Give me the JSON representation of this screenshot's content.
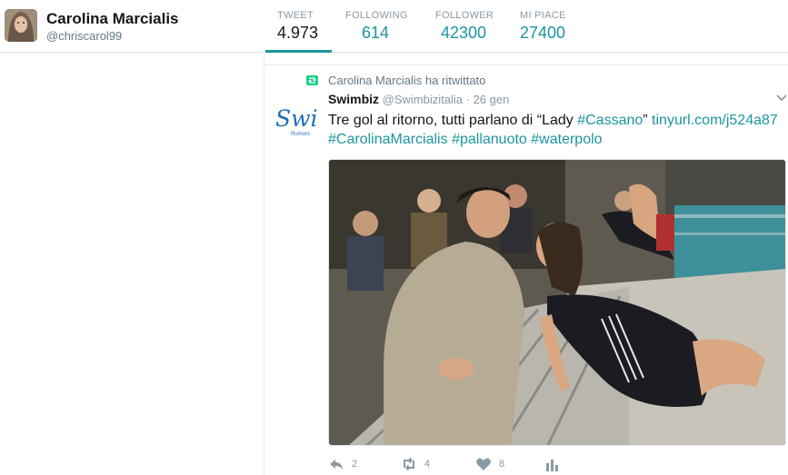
{
  "profile": {
    "name": "Carolina Marcialis",
    "handle": "@chriscarol99"
  },
  "stats": [
    {
      "label": "TWEET",
      "value": "4.973"
    },
    {
      "label": "FOLLOWING",
      "value": "614"
    },
    {
      "label": "FOLLOWER",
      "value": "42300"
    },
    {
      "label": "MI PIACE",
      "value": "27400"
    }
  ],
  "tweet": {
    "retweet_context": "Carolina Marcialis ha ritwittato",
    "author_name": "Swimbiz",
    "author_handle": "@Swimbizitalia",
    "separator": "·",
    "date": "26 gen",
    "text_plain": "Tre gol al ritorno, tutti parlano di “Lady ",
    "hashtag_cassano": "#Cassano",
    "text_close_quote": "” ",
    "link": "tinyurl.com/j524a87",
    "hashtag_1": "#CarolinaMarcialis",
    "hashtag_2": "#pallanuoto",
    "hashtag_3": "#waterpolo",
    "avatar_logo_text": "Swi",
    "avatar_logo_sub": "Rumors",
    "reply_count": "2",
    "retweet_count": "4",
    "like_count": "8"
  },
  "colors": {
    "accent": "#1b95a0",
    "retweet_green": "#19cf86",
    "muted": "#8899a6"
  },
  "icons": [
    "dropdown-caret-icon",
    "retweet-icon",
    "reply-icon",
    "like-icon",
    "analytics-icon"
  ]
}
